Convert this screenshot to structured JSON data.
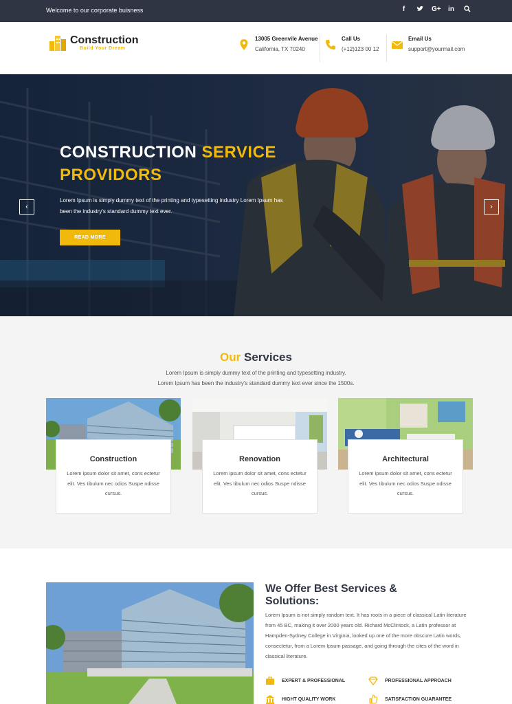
{
  "topbar": {
    "welcome": "Welcome to our corporate buisness",
    "social": [
      {
        "icon": "facebook-icon",
        "glyph": "f"
      },
      {
        "icon": "twitter-icon",
        "glyph": "t"
      },
      {
        "icon": "google-plus-icon",
        "glyph": "G+"
      },
      {
        "icon": "linkedin-icon",
        "glyph": "in"
      },
      {
        "icon": "search-icon",
        "glyph": "⌕"
      }
    ]
  },
  "header": {
    "logo_name": "Construction",
    "logo_tagline": "Build Your Dream",
    "address": {
      "line1": "13005 Greenvile Avenue",
      "line2": "California, TX 70240"
    },
    "phone": {
      "label": "Call Us",
      "value": "(+12)123 00 12"
    },
    "email": {
      "label": "Email Us",
      "value": "support@yourmail.com"
    }
  },
  "hero": {
    "title_white": "CONSTRUCTION",
    "title_accent": "SERVICE",
    "title_line2": "PROVIDORS",
    "description": "Lorem Ipsum is simply dummy text of the printing and typesetting industry Lorem Ipsum has been the industry's standard dummy text ever.",
    "button": "READ MORE",
    "prev": "‹",
    "next": "›"
  },
  "services": {
    "title_accent": "Our",
    "title_rest": "Services",
    "subtitle_line1": "Lorem Ipsum is simply dummy text of the printing and typesetting industry.",
    "subtitle_line2": "Lorem Ipsum has been the industry's standard dummy text ever since the 1500s.",
    "cards": [
      {
        "title": "Construction",
        "text": "Lorem ipsum dolor sit amet, cons ectetur elit. Ves tibulum nec odios Suspe ndisse cursus."
      },
      {
        "title": "Renovation",
        "text": "Lorem ipsum dolor sit amet, cons ectetur elit. Ves tibulum nec odios Suspe ndisse cursus."
      },
      {
        "title": "Architectural",
        "text": "Lorem ipsum dolor sit amet, cons ectetur elit. Ves tibulum nec odios Suspe ndisse cursus."
      }
    ]
  },
  "offer": {
    "title": "We Offer Best Services & Solutions:",
    "description": "Lorem Ipsum is not simply random text. It has roots in a piece of classical Latin literature from 45 BC, making it over 2000 years old. Richard McClintock, a Latin professor at Hampden-Sydney College in Virginia, looked up one of the more obscure Latin words, consectetur, from a Lorem Ipsum passage, and going through the cites of the word in classical literature.",
    "features": [
      {
        "label": "EXPERT & PROFESSIONAL",
        "icon": "briefcase-icon"
      },
      {
        "label": "PROFESSIONAL APPROACH",
        "icon": "diamond-icon"
      },
      {
        "label": "HIGHT QUALITY WORK",
        "icon": "bank-icon"
      },
      {
        "label": "SATISFACTION GUARANTEE",
        "icon": "thumbs-up-icon"
      }
    ]
  },
  "colors": {
    "accent": "#f0b90b",
    "dark": "#2f3542"
  }
}
